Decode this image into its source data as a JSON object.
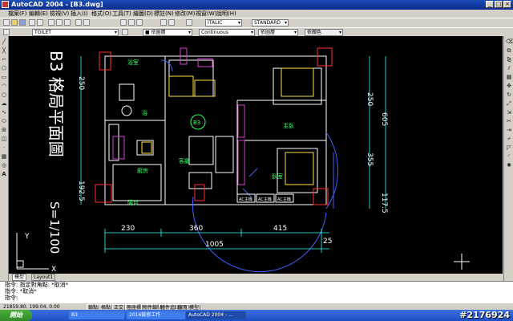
{
  "window": {
    "title": "AutoCAD 2004 - [B3.dwg]"
  },
  "menus": [
    "檔案(F)",
    "編輯(E)",
    "檢視(V)",
    "插入(I)",
    "格式(O)",
    "工具(T)",
    "繪圖(D)",
    "標註(N)",
    "修改(M)",
    "視窗(W)",
    "說明(H)"
  ],
  "toolbar": {
    "text_style": "ITALIC",
    "dim_style": "STANDARD",
    "layer": "TOILET",
    "color": "■ 依圖層",
    "linetype": "Continuous",
    "lineweight": "依圖層",
    "plot_style": "依顏色"
  },
  "drawing": {
    "title": "B3 格局平面圖",
    "scale": "S=1/100",
    "unit_label": "B3",
    "dims_right": [
      "250",
      "605",
      "355",
      "117.5"
    ],
    "dims_left": [
      "250",
      "192.5"
    ],
    "dims_bottom": [
      "230",
      "360",
      "415",
      "25"
    ],
    "dim_total": "1005",
    "ac_labels": [
      "AC主機",
      "AC主機",
      "AC主機"
    ],
    "ucs": {
      "x": "X",
      "y": "Y"
    }
  },
  "tabs": [
    "模型",
    "Layout1"
  ],
  "command": {
    "line1": "指令: 指定對角點: *取消*",
    "line2": "指令: *取消*",
    "line3": "指令:"
  },
  "status": {
    "coords": "21859.80, 199.04, 0.00",
    "buttons": [
      "鎖點",
      "格點",
      "正交",
      "極座標",
      "物件鎖點",
      "物件追蹤",
      "線寬",
      "模型"
    ]
  },
  "taskbar": {
    "start": "開始",
    "tasks": [
      "B3",
      "2016裝修工作",
      "AutoCAD 2004 - ..."
    ],
    "watermark": "#2176924"
  }
}
